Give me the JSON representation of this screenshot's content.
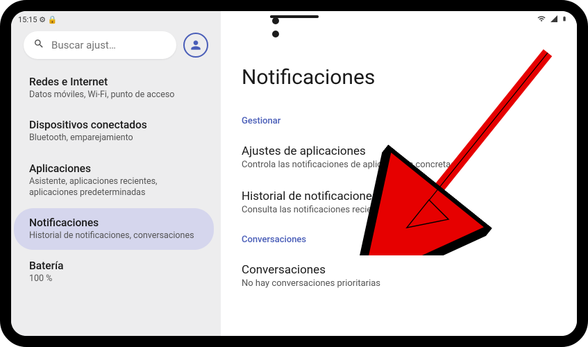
{
  "status": {
    "time": "15:15"
  },
  "search": {
    "placeholder": "Buscar ajust…"
  },
  "nav": [
    {
      "title": "Redes e Internet",
      "subtitle": "Datos móviles, Wi-Fi, punto de acceso"
    },
    {
      "title": "Dispositivos conectados",
      "subtitle": "Bluetooth, emparejamiento"
    },
    {
      "title": "Aplicaciones",
      "subtitle": "Asistente, aplicaciones recientes, aplicaciones predeterminadas"
    },
    {
      "title": "Notificaciones",
      "subtitle": "Historial de notificaciones, conversaciones"
    },
    {
      "title": "Batería",
      "subtitle": "100 %"
    }
  ],
  "page": {
    "title": "Notificaciones",
    "sections": [
      {
        "header": "Gestionar",
        "rows": [
          {
            "title": "Ajustes de aplicaciones",
            "subtitle": "Controla las notificaciones de aplicaciones concretas"
          },
          {
            "title": "Historial de notificaciones",
            "subtitle": "Consulta las notificaciones recientes y pospuestas"
          }
        ]
      },
      {
        "header": "Conversaciones",
        "rows": [
          {
            "title": "Conversaciones",
            "subtitle": "No hay conversaciones prioritarias"
          }
        ]
      }
    ]
  }
}
